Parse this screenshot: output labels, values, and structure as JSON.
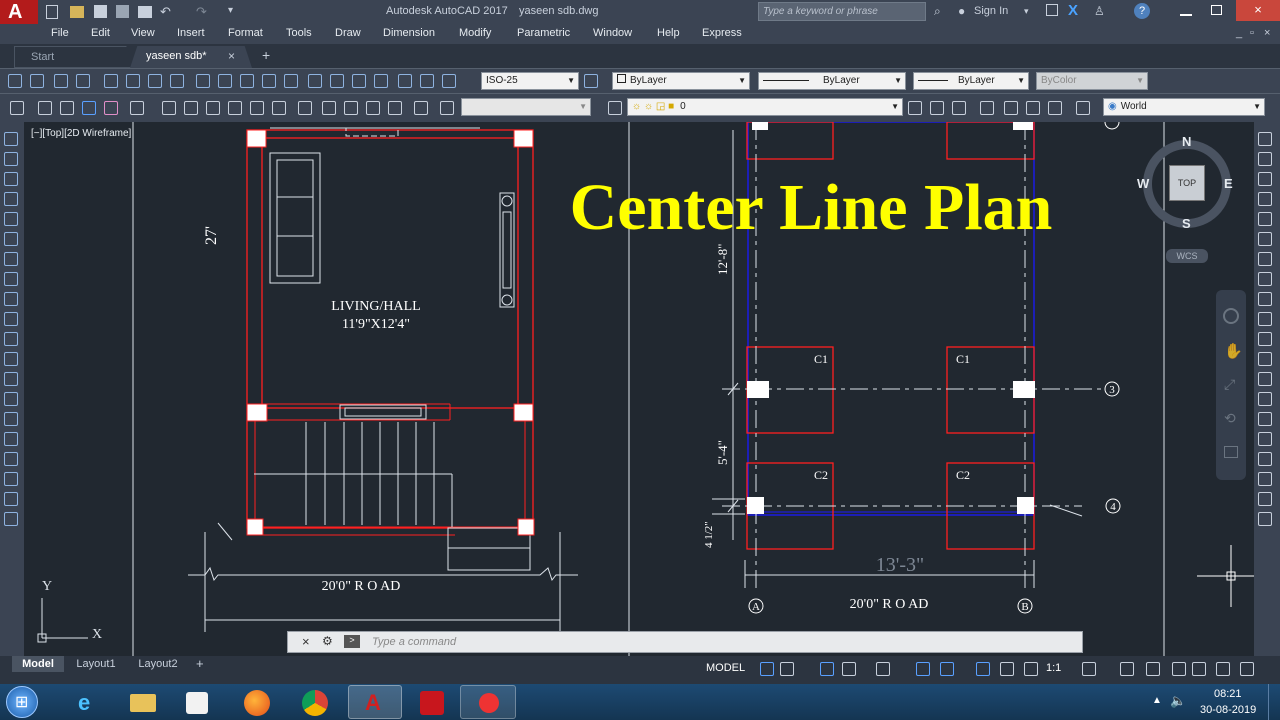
{
  "window": {
    "app_title": "Autodesk AutoCAD 2017",
    "file_name": "yaseen sdb.dwg",
    "search_placeholder": "Type a keyword or phrase",
    "sign_in": "Sign In",
    "help": "?"
  },
  "app_button": "A",
  "menu": [
    "File",
    "Edit",
    "View",
    "Insert",
    "Format",
    "Tools",
    "Draw",
    "Dimension",
    "Modify",
    "Parametric",
    "Window",
    "Help",
    "Express"
  ],
  "tabs": {
    "start": "Start",
    "active": "yaseen sdb*",
    "active_close": "×",
    "add": "+"
  },
  "toolbar": {
    "dimstyle": "ISO-25",
    "color": "ByLayer",
    "linetype": "ByLayer",
    "lineweight": "ByLayer",
    "plotstyle": "ByColor",
    "layer": "0",
    "ucs": "World"
  },
  "viewport": {
    "label": "[−][Top][2D Wireframe]"
  },
  "drawing": {
    "title": "Center Line Plan",
    "dim_27": "27'",
    "room_name": "LIVING/HALL",
    "room_size": "11'9\"X12'4\"",
    "road_left": "20'0\" R O AD",
    "road_right": "20'0\" R O AD",
    "dim_12_8": "12'-8\"",
    "dim_5_4": "5'-4\"",
    "dim_small": "4 1/2\"",
    "dim_13_3": "13'-3\"",
    "col_c1": "C1",
    "col_c2": "C2",
    "grid_3": "3",
    "grid_4": "4",
    "grid_a": "A",
    "grid_b": "B"
  },
  "viewcube": {
    "north": "N",
    "south": "S",
    "east": "E",
    "west": "W",
    "top": "TOP",
    "wcs": "WCS"
  },
  "ucs_icon": {
    "y": "Y",
    "x": "X"
  },
  "command_line": {
    "placeholder": "Type a command"
  },
  "layout_tabs": [
    "Model",
    "Layout1",
    "Layout2"
  ],
  "layout_add": "+",
  "status": {
    "model": "MODEL",
    "scale": "1:1"
  },
  "taskbar": {
    "time": "08:21",
    "date": "30-08-2019"
  },
  "colors": {
    "titlebar": "#3b4453",
    "canvas": "#212830",
    "accent_title": "#ffff00",
    "wall_red": "#ff2020",
    "blue_line": "#1a1aff"
  }
}
